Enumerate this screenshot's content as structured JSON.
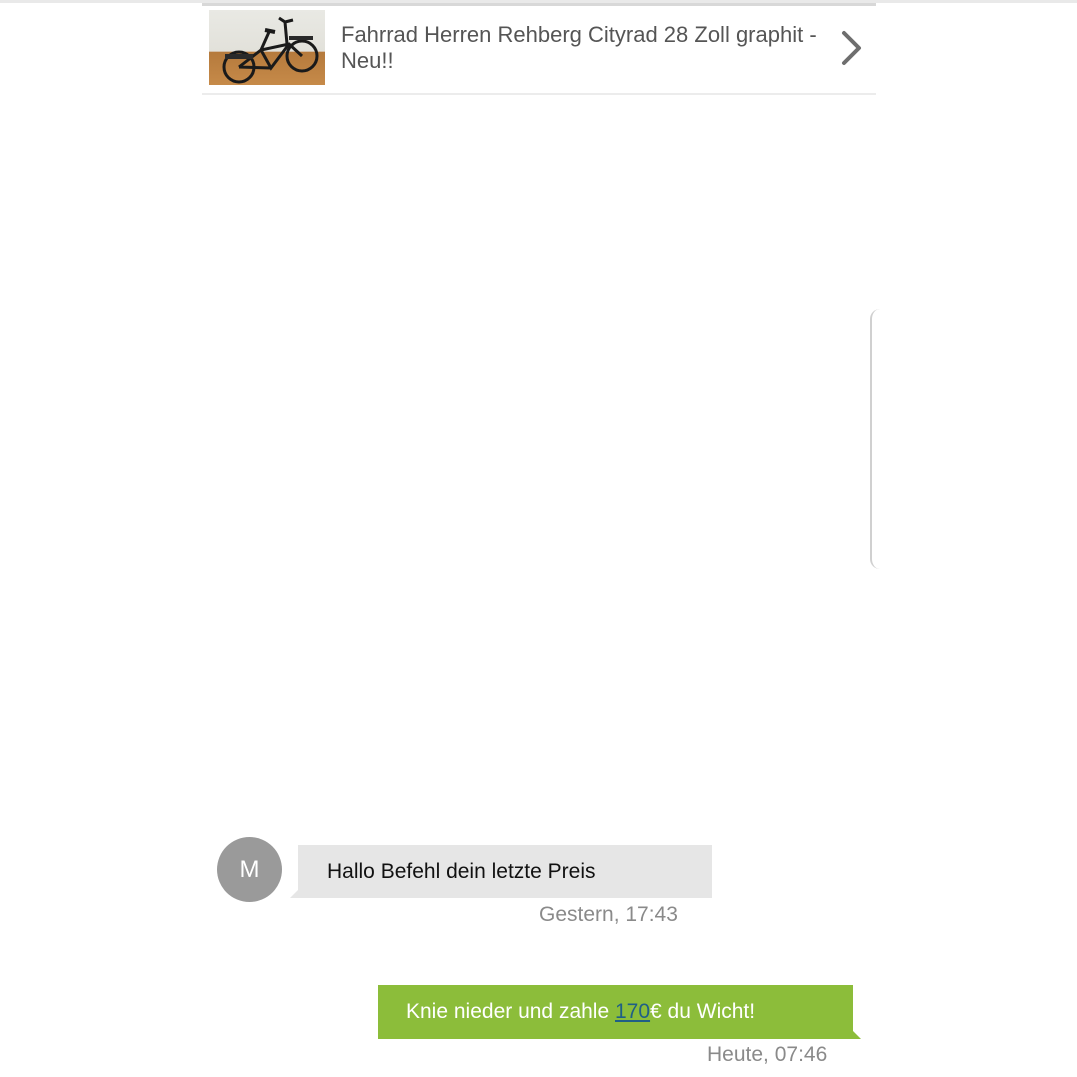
{
  "listing": {
    "title": "Fahrrad Herren Rehberg Cityrad 28 Zoll graphit - Neu!!",
    "thumbnail_icon": "bicycle-photo",
    "chevron_icon": "chevron-right-icon"
  },
  "messages": [
    {
      "direction": "incoming",
      "avatar_initial": "M",
      "text": "Hallo Befehl dein letzte Preis",
      "time": "Gestern, 17:43"
    },
    {
      "direction": "outgoing",
      "text_before": "Knie nieder und zahle ",
      "price": "170",
      "text_after": "€ du Wicht!",
      "time": "Heute, 07:46"
    }
  ],
  "colors": {
    "outgoing_bubble": "#8cbd3a",
    "incoming_bubble": "#e6e6e6",
    "avatar": "#9a9a9a",
    "link": "#1f5f86"
  }
}
